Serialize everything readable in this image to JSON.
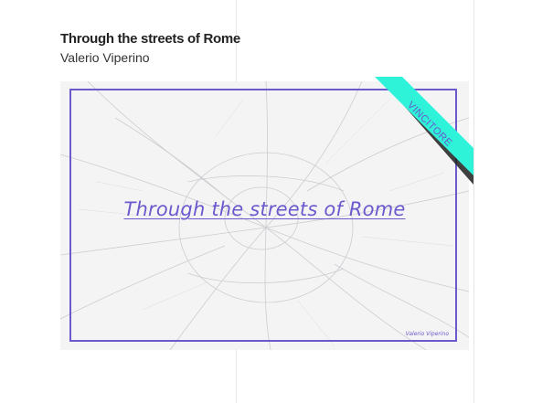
{
  "card": {
    "title": "Through the streets of Rome",
    "author": "Valerio Viperino"
  },
  "poster": {
    "title": "Through the streets of Rome",
    "signature": "Valerio Viperino"
  },
  "badge": {
    "label": "VINCITORE"
  },
  "colors": {
    "accent": "#6a5acd",
    "ribbon": "#2ef3d8",
    "map_bg": "#f4f4f5"
  }
}
